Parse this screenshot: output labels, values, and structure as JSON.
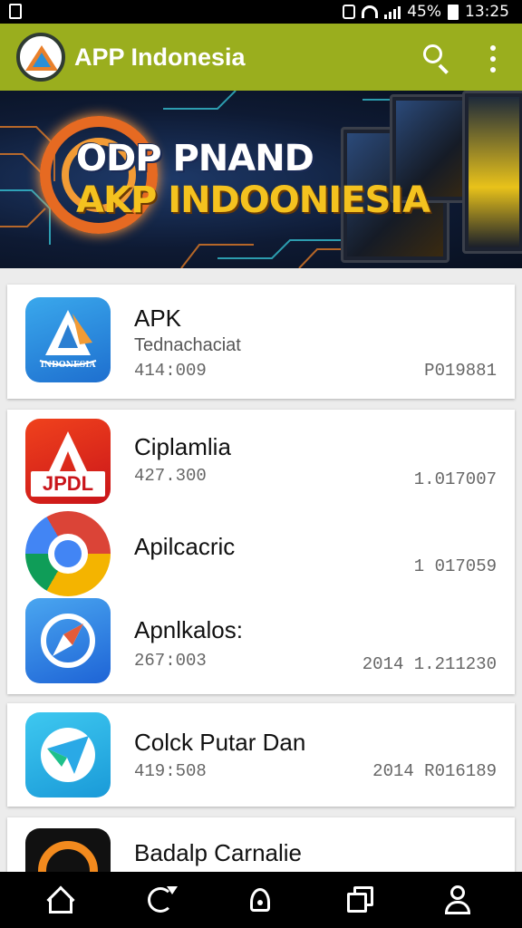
{
  "status_bar": {
    "battery_percent": "45%",
    "time": "13:25"
  },
  "app_bar": {
    "title": "APP Indonesia",
    "logo_icon": "triangle-logo-icon",
    "search_icon": "search-icon",
    "more_icon": "more-vert-icon",
    "color": "#9aae1e"
  },
  "banner": {
    "line1": "ODP PNAND",
    "line2": "AKP INDOONIESIA",
    "accent_color": "#f4c21f"
  },
  "apps": [
    {
      "title": "APK",
      "subtitle": "Tednachaciat",
      "meta_left": "414:009",
      "meta_right": "P019881",
      "icon": "apk-mountain-icon",
      "icon_text": "INDONESIA"
    },
    {
      "title": "Ciplamlia",
      "subtitle": "",
      "meta_left": "427.300",
      "meta_right": "1.017007",
      "icon": "red-a-icon",
      "icon_text": "JPDL"
    },
    {
      "title": "Apilcacric",
      "subtitle": "",
      "meta_left": "",
      "meta_right": "1 017059",
      "icon": "chrome-icon",
      "icon_text": ""
    },
    {
      "title": "Apnlkalos:",
      "subtitle": "",
      "meta_left": "267:003",
      "meta_right": "2014 1.211230",
      "icon": "compass-icon",
      "icon_text": ""
    },
    {
      "title": "Colck Putar Dan",
      "subtitle": "",
      "meta_left": "419:508",
      "meta_right": "2014 R016189",
      "icon": "paper-plane-icon",
      "icon_text": ""
    },
    {
      "title": "Badalp Carnalie",
      "subtitle": "",
      "meta_left": "",
      "meta_right": "",
      "icon": "orange-ring-icon",
      "icon_text": ""
    }
  ],
  "bottom_nav": {
    "items": [
      "home-icon",
      "refresh-icon",
      "location-icon",
      "windows-icon",
      "profile-icon"
    ]
  }
}
